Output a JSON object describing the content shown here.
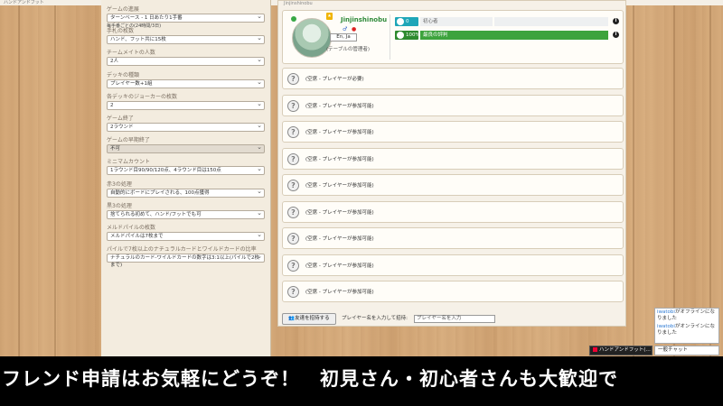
{
  "topbar": {
    "text": "ハンドアンドフット"
  },
  "settings": [
    {
      "label": "ゲームの進展",
      "value": "ターンベース - 1 日あたり1手番",
      "sub": "毎手番ごとの(24時間/3日)"
    },
    {
      "label": "手札の枚数",
      "value": "ハンド、フット共に15枚",
      "sub": ""
    },
    {
      "label": "チームメイトの人数",
      "value": "2人",
      "sub": ""
    },
    {
      "label": "デッキの種類",
      "value": "プレイヤー数+1組",
      "sub": ""
    },
    {
      "label": "各デッキのジョーカーの枚数",
      "value": "2",
      "sub": ""
    },
    {
      "label": "ゲーム終了",
      "value": "2ラウンド",
      "sub": ""
    },
    {
      "label": "ゲームの早期終了",
      "value": "不可",
      "sub": "",
      "dim": true
    },
    {
      "label": "ミニマムカウント",
      "value": "1ラウンド目90/90/120点、4ラウンド目は150点",
      "sub": ""
    },
    {
      "label": "赤3の処理",
      "value": "自動的にボードにプレイされる、100点獲得",
      "sub": ""
    },
    {
      "label": "黒3の処理",
      "value": "捨てられる初めて、ハンド/フットでも可",
      "sub": ""
    },
    {
      "label": "メルドパイルの枚数",
      "value": "メルドパイルは7枚まで",
      "sub": ""
    },
    {
      "label": "パイルで7枚以上のナチュラルカードとワイルドカードの比率",
      "value": "ナチュラルのカード-ワイルドカードの数字は3:1以上(パイルで2枚まで)",
      "sub": ""
    }
  ],
  "main": {
    "header": "Jinjinshinobu",
    "player": {
      "name": "Jinjinshinobu",
      "lang": "En, Ja",
      "seat_note": "(テーブルの管理者)",
      "stat1_value": "0",
      "stat1_label": "初心者",
      "stat2_value": "100%",
      "stat2_label": "最良の評判",
      "colors": {
        "stat1": "#1ea6b8",
        "stat2": "#3da33d"
      }
    },
    "seats": [
      {
        "icon": "question-icon",
        "text": "(空席 - プレイヤーが必要)"
      },
      {
        "icon": "question-icon",
        "text": "(空席 - プレイヤーが参加可能)"
      },
      {
        "icon": "question-icon",
        "text": "(空席 - プレイヤーが参加可能)"
      },
      {
        "icon": "question-icon",
        "text": "(空席 - プレイヤーが参加可能)"
      },
      {
        "icon": "question-icon",
        "text": "(空席 - プレイヤーが参加可能)"
      },
      {
        "icon": "question-icon",
        "text": "(空席 - プレイヤーが参加可能)"
      },
      {
        "icon": "question-icon",
        "text": "(空席 - プレイヤーが参加可能)"
      },
      {
        "icon": "question-icon",
        "text": "(空席 - プレイヤーが参加可能)"
      },
      {
        "icon": "question-icon",
        "text": "(空席 - プレイヤーが参加可能)"
      }
    ],
    "invite": {
      "button": "友達を招待する",
      "label": "プレイヤー名を入力して招待:",
      "placeholder": "プレイヤー名を入力"
    }
  },
  "chat": {
    "messages": [
      {
        "user": "iwatobi",
        "text": "がオフラインになりました"
      },
      {
        "user": "iwatobi",
        "text": "がオンラインになりました"
      }
    ],
    "button": "一般チャット",
    "game_tab": "ハンドアンドフット(…"
  },
  "caption": "フレンド申請はお気軽にどうぞ！　初見さん・初心者さんも大歓迎で"
}
